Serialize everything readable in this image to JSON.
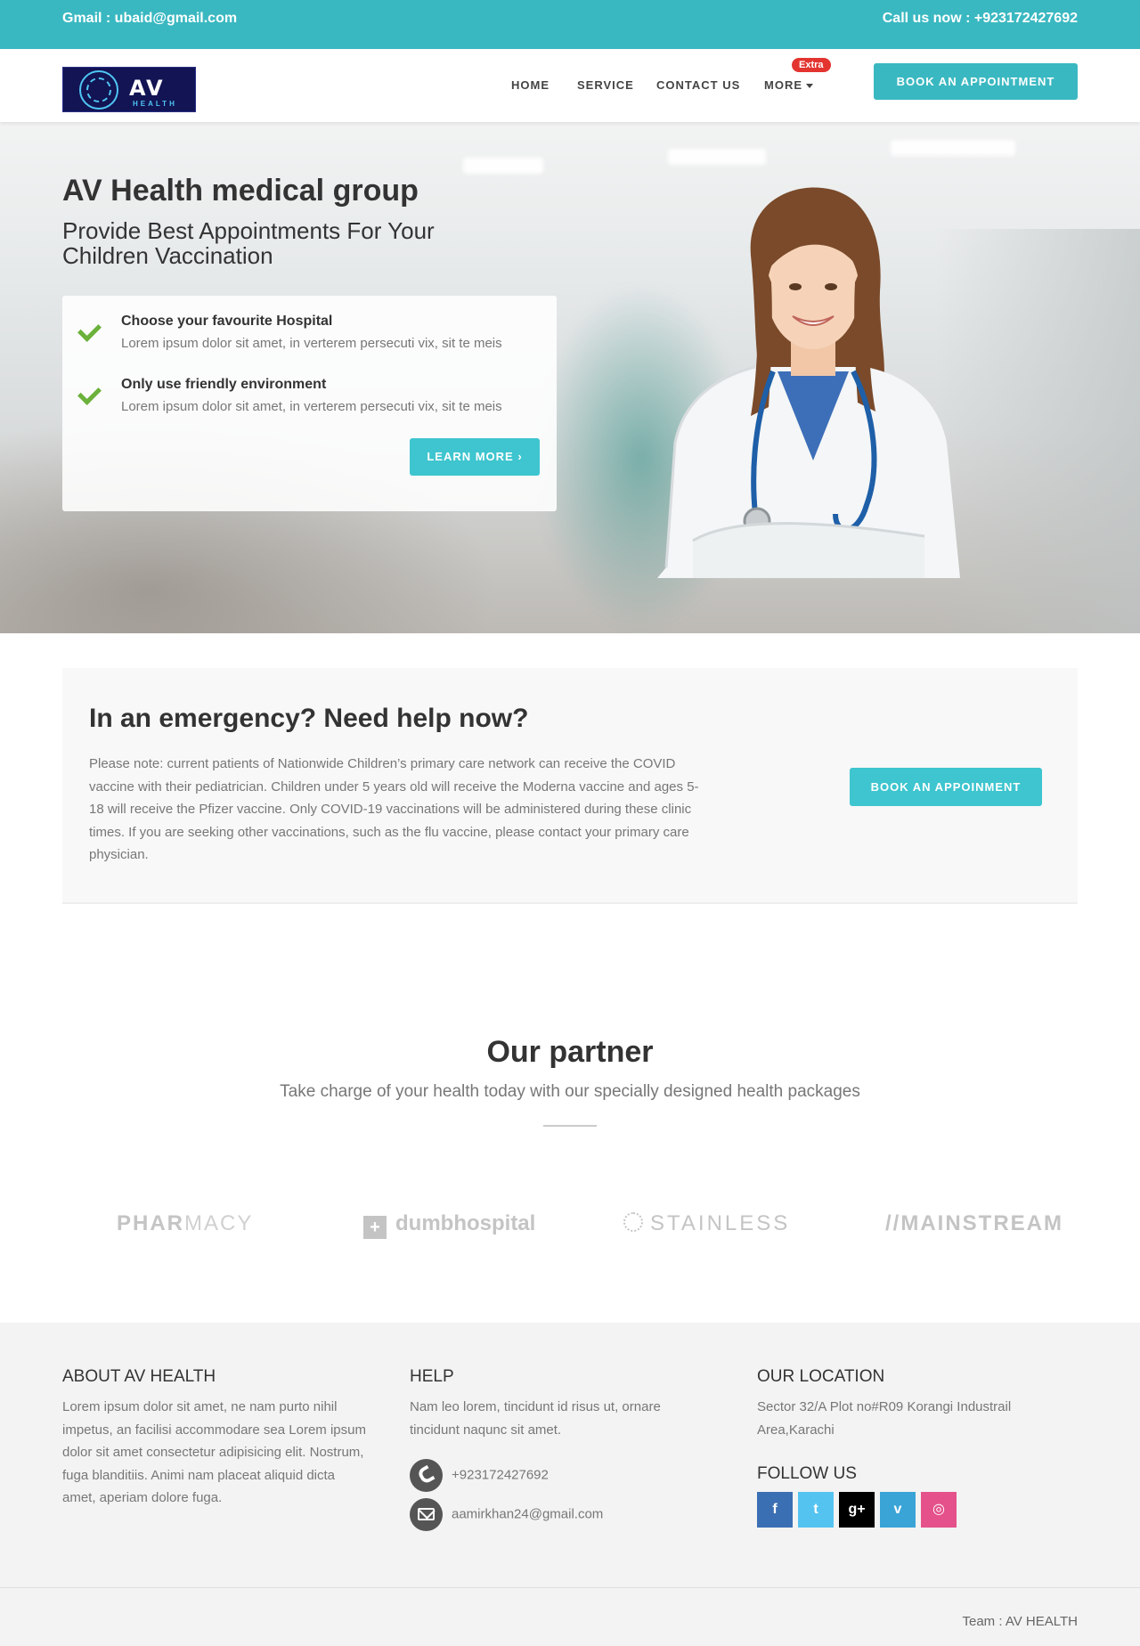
{
  "topbar": {
    "email": "Gmail : ubaid@gmail.com",
    "phone": "Call us now : +923172427692",
    "color": "#3ab8c1"
  },
  "logo": {
    "text": "AV",
    "subtext": "HEALTH"
  },
  "nav": {
    "items": [
      "HOME",
      "SERVICE",
      "CONTACT US",
      "MORE"
    ],
    "badge": "Extra",
    "cta": "BOOK AN APPOINTMENT"
  },
  "hero": {
    "title": "AV Health medical group",
    "subtitle": "Provide Best Appointments For Your Children Vaccination",
    "features": [
      {
        "title": "Choose your favourite Hospital",
        "text": "Lorem ipsum dolor sit amet, in verterem persecuti vix, sit te meis"
      },
      {
        "title": "Only use friendly environment",
        "text": "Lorem ipsum dolor sit amet, in verterem persecuti vix, sit te meis"
      }
    ],
    "button": "LEARN MORE ›"
  },
  "emergency": {
    "title": "In an emergency? Need help now?",
    "text": "Please note: current patients of Nationwide Children’s primary care network can receive the COVID vaccine with their pediatrician. Children under 5 years old will receive the Moderna vaccine and ages 5-18 will receive the Pfizer vaccine. Only COVID-19 vaccinations will be administered during these clinic times. If you are seeking other vaccinations, such as the flu vaccine, please contact your primary care physician.",
    "button": "BOOK AN APPOINMENT"
  },
  "partner": {
    "title": "Our partner",
    "subtitle": "Take charge of your health today with our specially designed health packages",
    "logos": {
      "pharmacy_bold": "PHAR",
      "pharmacy_light": "MACY",
      "dumb": "dumbhospital",
      "stainless": "STAINLESS",
      "mainstream": "//MAINSTREAM"
    }
  },
  "footer": {
    "about": {
      "heading": "ABOUT AV HEALTH",
      "text": "Lorem ipsum dolor sit amet, ne nam purto nihil impetus, an facilisi accommodare sea Lorem ipsum dolor sit amet consectetur adipisicing elit. Nostrum, fuga blanditiis. Animi nam placeat aliquid dicta amet, aperiam dolore fuga."
    },
    "help": {
      "heading": "HELP",
      "text": "Nam leo lorem, tincidunt id risus ut, ornare tincidunt naqunc sit amet.",
      "phone": "+923172427692",
      "email": "aamirkhan24@gmail.com"
    },
    "location": {
      "heading": "OUR LOCATION",
      "text": "Sector 32/A Plot no#R09 Korangi Industrail Area,Karachi",
      "follow_heading": "FOLLOW US",
      "social_icons": [
        "facebook-icon",
        "twitter-icon",
        "google-plus-icon",
        "vimeo-icon",
        "dribbble-icon"
      ],
      "social_glyphs": [
        "f",
        "t",
        "g+",
        "v",
        "◎"
      ]
    },
    "team": "Team : AV HEALTH"
  }
}
